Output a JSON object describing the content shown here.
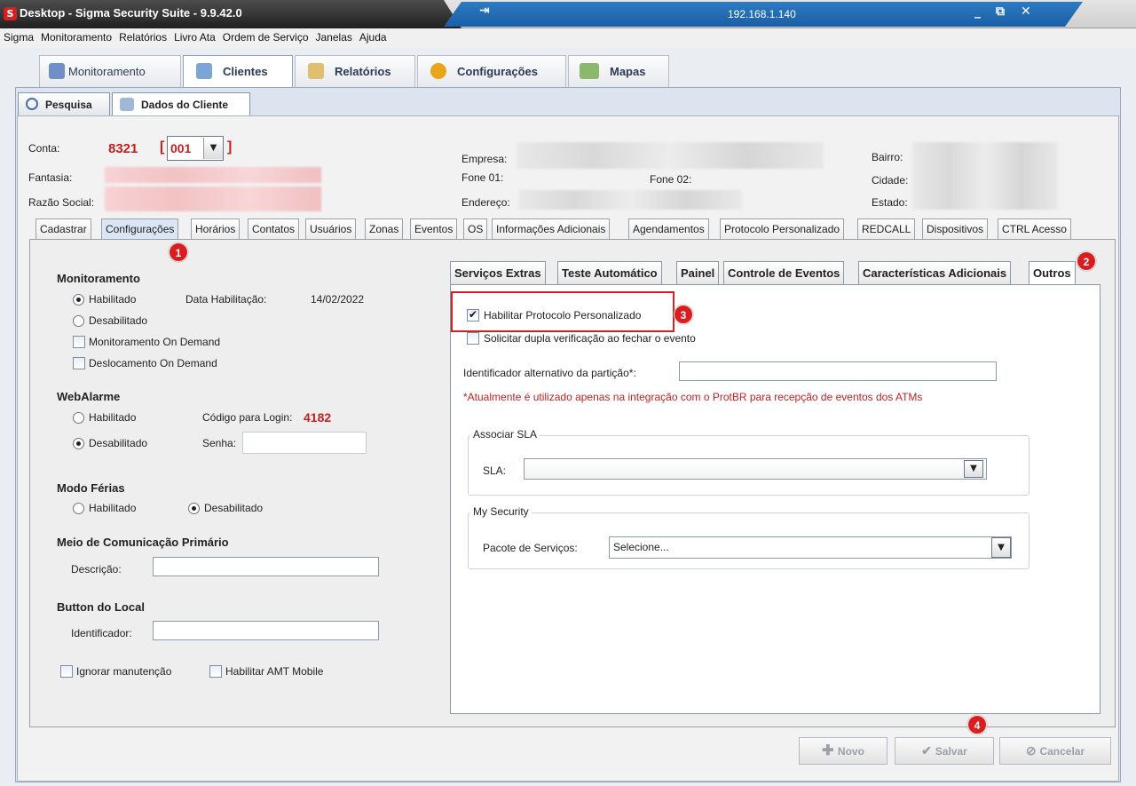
{
  "window": {
    "title": "Desktop - Sigma Security Suite - 9.9.42.0",
    "ip": "192.168.1.140",
    "pin": "⇥",
    "minimize": "_",
    "restore": "⧉",
    "close": "✕"
  },
  "menu": [
    "Sigma",
    "Monitoramento",
    "Relatórios",
    "Livro Ata",
    "Ordem de Serviço",
    "Janelas",
    "Ajuda"
  ],
  "main_tabs": [
    {
      "label": "Monitoramento",
      "icon": "network-icon"
    },
    {
      "label": "Clientes",
      "icon": "clients-icon"
    },
    {
      "label": "Relatórios",
      "icon": "report-icon"
    },
    {
      "label": "Configurações",
      "icon": "gear-icon"
    },
    {
      "label": "Mapas",
      "icon": "map-icon"
    }
  ],
  "sub_tabs": [
    {
      "label": "Pesquisa"
    },
    {
      "label": "Dados do Cliente"
    }
  ],
  "client": {
    "conta_label": "Conta:",
    "conta_value": "8321",
    "particao_open": "[",
    "particao": "001",
    "particao_close": "]",
    "fantasia_label": "Fantasia:",
    "razao_label": "Razão Social:",
    "empresa_label": "Empresa:",
    "fone1_label": "Fone 01:",
    "fone2_label": "Fone 02:",
    "endereco_label": "Endereço:",
    "bairro_label": "Bairro:",
    "cidade_label": "Cidade:",
    "estado_label": "Estado:"
  },
  "detail_tabs": [
    "Cadastrar",
    "Configurações",
    "Horários",
    "Contatos",
    "Usuários",
    "Zonas",
    "Eventos",
    "OS",
    "Informações Adicionais",
    "Agendamentos",
    "Protocolo Personalizado",
    "REDCALL",
    "Dispositivos",
    "CTRL Acesso"
  ],
  "left": {
    "monitoramento_title": "Monitoramento",
    "habilitado": "Habilitado",
    "data_hab_label": "Data Habilitação:",
    "data_hab_value": "14/02/2022",
    "desabilitado": "Desabilitado",
    "mon_on_demand": "Monitoramento On Demand",
    "desl_on_demand": "Deslocamento On Demand",
    "webalarme_title": "WebAlarme",
    "wa_habilitado": "Habilitado",
    "codigo_label": "Código para Login:",
    "codigo_value": "4182",
    "wa_desabilitado": "Desabilitado",
    "senha_label": "Senha:",
    "ferias_title": "Modo Férias",
    "f_habilitado": "Habilitado",
    "f_desabilitado": "Desabilitado",
    "meio_title": "Meio de Comunicação Primário",
    "descricao_label": "Descrição:",
    "button_title": "Button do Local",
    "identificador_label": "Identificador:",
    "ignorar": "Ignorar manutenção",
    "amt": "Habilitar AMT Mobile"
  },
  "right_tabs": [
    "Serviços Extras",
    "Teste Automático",
    "Painel",
    "Controle de Eventos",
    "Características Adicionais",
    "Outros"
  ],
  "outros": {
    "habilitar_protocolo": "Habilitar Protocolo Personalizado",
    "dupla_verificacao": "Solicitar dupla verificação ao fechar o evento",
    "identificador_alt_label": "Identificador alternativo da partição*:",
    "nota": "*Atualmente é utilizado apenas na integração com o ProtBR para recepção de eventos dos ATMs",
    "sla_group": "Associar SLA",
    "sla_label": "SLA:",
    "sla_value": "",
    "mysec_group": "My Security",
    "pacote_label": "Pacote de Serviços:",
    "pacote_value": "Selecione..."
  },
  "buttons": {
    "novo": "Novo",
    "salvar": "Salvar",
    "cancelar": "Cancelar"
  },
  "badges": [
    "1",
    "2",
    "3",
    "4"
  ]
}
